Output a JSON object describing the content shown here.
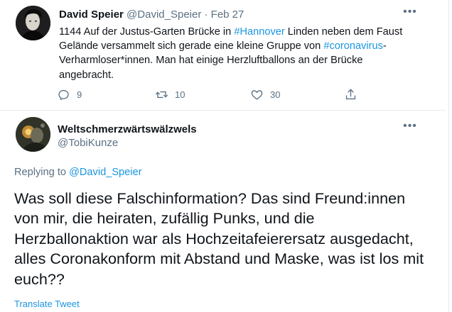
{
  "colors": {
    "text_primary": "#0f1419",
    "text_secondary": "#5b7083",
    "link": "#1b95e0",
    "divider": "#e6ecf0"
  },
  "tweet1": {
    "author_name": "David Speier",
    "author_handle": "@David_Speier",
    "separator": "·",
    "date": "Feb 27",
    "body_part1": "1144 Auf der Justus-Garten Brücke in ",
    "hashtag1": "#Hannover",
    "body_part2": " Linden neben dem Faust Gelände versammelt sich gerade eine kleine Gruppe von ",
    "hashtag2": "#coronavirus",
    "body_part3": "-Verharmloser*innen. Man hat einige Herzluftballons an der Brücke angebracht.",
    "reply_count": "9",
    "retweet_count": "10",
    "like_count": "30",
    "more_icon": "more-horizontal-icon"
  },
  "reply": {
    "author_name": "Weltschmerzwärtswälzwels",
    "author_handle": "@TobiKunze",
    "replying_prefix": "Replying to",
    "replying_handle": "@David_Speier",
    "text": "Was soll diese Falschinformation? Das sind Freund:innen von mir, die heiraten, zufällig Punks, und die Herzballonaktion war als Hochzeitafeierersatz ausgedacht, alles Coronakonform mit Abstand und Maske, was ist los mit euch??",
    "translate_label": "Translate Tweet",
    "more_icon": "more-horizontal-icon"
  }
}
